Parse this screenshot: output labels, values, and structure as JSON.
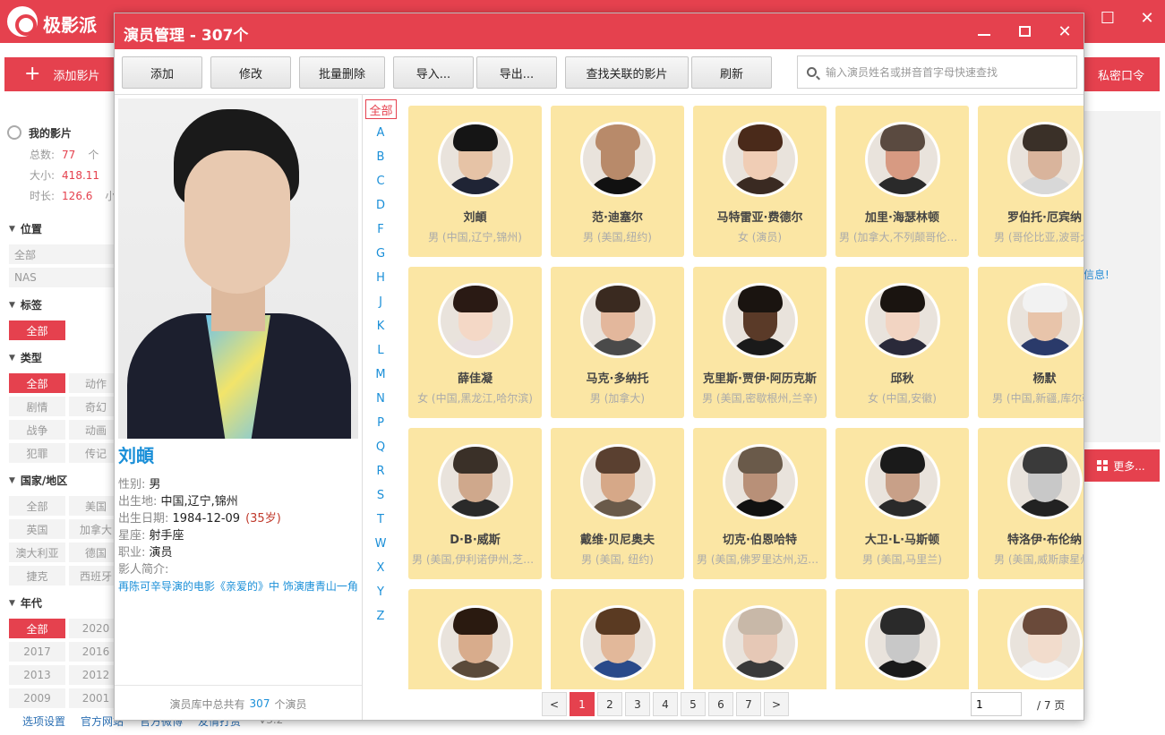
{
  "app": {
    "name": "极影派",
    "add_movie_label": "添加影片",
    "private_password_label": "私密口令",
    "right_note": "信息!",
    "more_label": "更多...",
    "my_movies": {
      "title": "我的影片",
      "total_label": "总数:",
      "total_value": "77",
      "total_unit": "个",
      "size_label": "大小:",
      "size_value": "418.11",
      "duration_label": "时长:",
      "duration_value": "126.6",
      "duration_unit": "小"
    },
    "location": {
      "title": "位置",
      "items": [
        "全部",
        "NAS"
      ]
    },
    "tags": {
      "title": "标签",
      "items": [
        "全部"
      ]
    },
    "genre": {
      "title": "类型",
      "items": [
        "全部",
        "动作",
        "剧情",
        "奇幻",
        "战争",
        "动画",
        "犯罪",
        "传记"
      ]
    },
    "region": {
      "title": "国家/地区",
      "items": [
        "全部",
        "美国",
        "英国",
        "加拿大",
        "澳大利亚",
        "德国",
        "捷克",
        "西班牙"
      ]
    },
    "year": {
      "title": "年代",
      "items": [
        "全部",
        "2020",
        "2017",
        "2016",
        "2013",
        "2012",
        "2009",
        "2001"
      ]
    },
    "footer": {
      "settings": "选项设置",
      "website": "官方网站",
      "weibo": "官方微博",
      "donate": "友情打赏",
      "version": "V3.2"
    }
  },
  "dialog": {
    "title": "演员管理 - 307个",
    "toolbar": {
      "add": "添加",
      "edit": "修改",
      "batch_delete": "批量删除",
      "import": "导入...",
      "export": "导出...",
      "find_movies": "查找关联的影片",
      "refresh": "刷新"
    },
    "search_placeholder": "输入演员姓名或拼音首字母快速查找",
    "selected_actor": {
      "name": "刘頔",
      "gender_label": "性别:",
      "gender": "男",
      "birthplace_label": "出生地:",
      "birthplace": "中国,辽宁,锦州",
      "birthday_label": "出生日期:",
      "birthday": "1984-12-09",
      "age": "(35岁)",
      "zodiac_label": "星座:",
      "zodiac": "射手座",
      "job_label": "职业:",
      "job": "演员",
      "bio_label": "影人简介:",
      "bio": "再陈可辛导演的电影《亲爱的》中 饰演唐青山一角"
    },
    "library_total_prefix": "演员库中总共有",
    "library_total_count": "307",
    "library_total_suffix": "个演员",
    "letter_all": "全部",
    "letters": [
      "A",
      "B",
      "C",
      "D",
      "F",
      "G",
      "H",
      "J",
      "K",
      "L",
      "M",
      "N",
      "P",
      "Q",
      "R",
      "S",
      "T",
      "W",
      "X",
      "Y",
      "Z"
    ],
    "actors": [
      {
        "name": "刘頔",
        "info": "男 (中国,辽宁,锦州)",
        "skin": "#e6c3a6",
        "hair": "#151515",
        "cloth": "#1f2435"
      },
      {
        "name": "范·迪塞尔",
        "info": "男 (美国,纽约)",
        "skin": "#b88a6a",
        "hair": "#b88a6a",
        "cloth": "#111111"
      },
      {
        "name": "马特雷亚·费德尔",
        "info": "女 (演员)",
        "skin": "#f0cdb5",
        "hair": "#4a2a1a",
        "cloth": "#3a2a22"
      },
      {
        "name": "加里·海瑟林顿",
        "info": "男 (加拿大,不列颠哥伦比亚)",
        "skin": "#d79a82",
        "hair": "#5a4a40",
        "cloth": "#2a2a2a"
      },
      {
        "name": "罗伯托·厄宾纳",
        "info": "男 (哥伦比亚,波哥大)",
        "skin": "#d9b49c",
        "hair": "#3a3028",
        "cloth": "#d8d8d8"
      },
      {
        "name": "薛佳凝",
        "info": "女 (中国,黑龙江,哈尔滨)",
        "skin": "#f4d8c6",
        "hair": "#2a1a14",
        "cloth": "#e9e0e0"
      },
      {
        "name": "马克·多纳托",
        "info": "男 (加拿大)",
        "skin": "#e3b79c",
        "hair": "#3a2a20",
        "cloth": "#4a4a4a"
      },
      {
        "name": "克里斯·贾伊·阿历克斯",
        "info": "男 (美国,密歇根州,兰辛)",
        "skin": "#5a3a28",
        "hair": "#1a1410",
        "cloth": "#1a1a1a"
      },
      {
        "name": "邱秋",
        "info": "女 (中国,安徽)",
        "skin": "#f2d4c2",
        "hair": "#1a1410",
        "cloth": "#2a2a3a"
      },
      {
        "name": "杨默",
        "info": "男 (中国,新疆,库尔勒)",
        "skin": "#e8c4aa",
        "hair": "#f2f2f2",
        "cloth": "#2a3a6a"
      },
      {
        "name": "D·B·威斯",
        "info": "男 (美国,伊利诺伊州,芝加哥)",
        "skin": "#cfa88c",
        "hair": "#3a3028",
        "cloth": "#2a2a2a"
      },
      {
        "name": "戴维·贝尼奥夫",
        "info": "男 (美国, 纽约)",
        "skin": "#d6a888",
        "hair": "#5a4030",
        "cloth": "#6a5a4a"
      },
      {
        "name": "切克·伯恩哈特",
        "info": "男 (美国,佛罗里达州,迈阿密)",
        "skin": "#b89078",
        "hair": "#6a5a4a",
        "cloth": "#111111"
      },
      {
        "name": "大卫·L·马斯顿",
        "info": "男 (美国,马里兰)",
        "skin": "#c8a088",
        "hair": "#1a1a1a",
        "cloth": "#2a2a2a"
      },
      {
        "name": "特洛伊·布伦纳",
        "info": "男 (美国,威斯康星州)",
        "skin": "#c8c8c8",
        "hair": "#3a3a3a",
        "cloth": "#222222"
      },
      {
        "name": "",
        "info": "",
        "skin": "#d8ac8c",
        "hair": "#2a1a10",
        "cloth": "#5a4a3a"
      },
      {
        "name": "",
        "info": "",
        "skin": "#e2b89a",
        "hair": "#5a3a22",
        "cloth": "#2a4a8a"
      },
      {
        "name": "",
        "info": "",
        "skin": "#e6c8b6",
        "hair": "#c8b8a8",
        "cloth": "#3a3a3a"
      },
      {
        "name": "",
        "info": "",
        "skin": "#c8c8c8",
        "hair": "#2a2a2a",
        "cloth": "#1a1a1a"
      },
      {
        "name": "",
        "info": "",
        "skin": "#f2dccc",
        "hair": "#6a4a3a",
        "cloth": "#f2f2f2"
      }
    ],
    "pagination": {
      "prev": "<",
      "next": ">",
      "pages": [
        "1",
        "2",
        "3",
        "4",
        "5",
        "6",
        "7"
      ],
      "current": "1",
      "input_value": "1",
      "total_label": "/ 7 页"
    },
    "colors": {
      "accent": "#e5414e",
      "card_bg": "#fbe6a4",
      "link": "#1a8fd8"
    }
  }
}
